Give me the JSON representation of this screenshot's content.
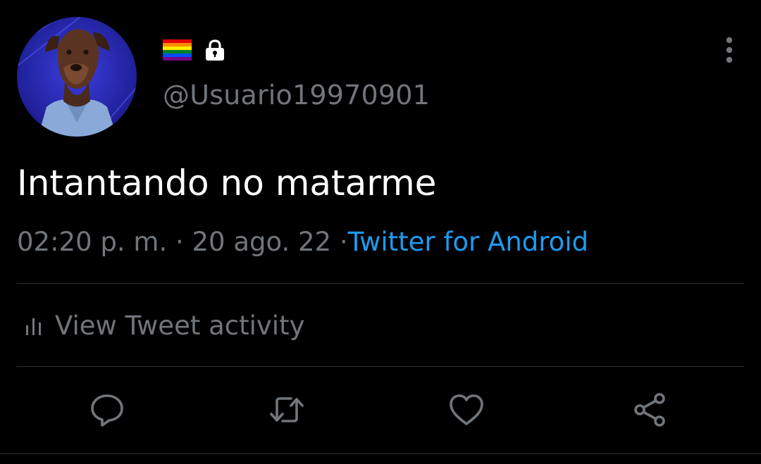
{
  "user": {
    "avatar_icon": "doberman-dog-in-denim-shirt-avatar",
    "flag_icon": "rainbow-pride-flag-icon",
    "lock_icon": "lock-icon",
    "handle": "@Usuario19970901"
  },
  "menu": {
    "icon": "more-vertical-icon"
  },
  "tweet": {
    "text": "Intantando no matarme",
    "time": "02:20 p. m.",
    "separator": "·",
    "date": "20 ago. 22",
    "source": "Twitter for Android"
  },
  "activity": {
    "icon": "bar-chart-icon",
    "label": "View Tweet activity"
  },
  "actions": [
    {
      "name": "reply",
      "icon": "reply-icon"
    },
    {
      "name": "retweet",
      "icon": "retweet-icon"
    },
    {
      "name": "like",
      "icon": "heart-icon"
    },
    {
      "name": "share",
      "icon": "share-icon"
    }
  ],
  "colors": {
    "background": "#000000",
    "text_primary": "#ffffff",
    "text_secondary": "#71767b",
    "accent": "#1d9bf0",
    "divider": "#2f3336",
    "icon": "#71767b"
  }
}
